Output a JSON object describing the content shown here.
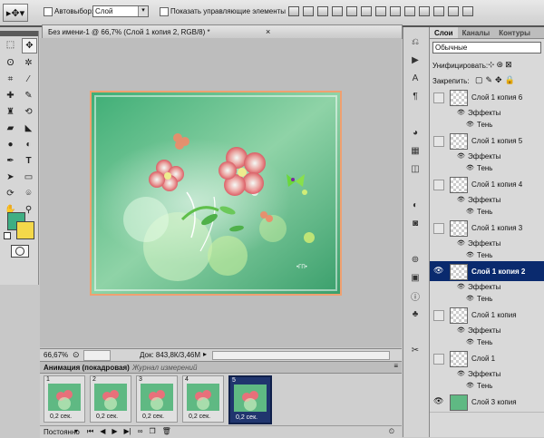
{
  "options_bar": {
    "autoselect_label": "Автовыбор:",
    "autoselect_value": "Слой",
    "show_controls_label": "Показать управляющие элементы"
  },
  "document": {
    "tab_title": "Без имени-1 @ 66,7% (Слой 1 копия 2, RGB/8) *",
    "zoom": "66,67%",
    "doc_info": "Док: 843,8К/3,46М",
    "watermark": "•ГП•"
  },
  "animation": {
    "tab_frames": "Анимация (покадровая)",
    "tab_measure": "Журнал измерений",
    "frames": [
      {
        "num": "1",
        "delay": "0,2 сек.",
        "selected": false
      },
      {
        "num": "2",
        "delay": "0,2 сек.",
        "selected": false
      },
      {
        "num": "3",
        "delay": "0,2 сек.",
        "selected": false
      },
      {
        "num": "4",
        "delay": "0,2 сек.",
        "selected": false
      },
      {
        "num": "5",
        "delay": "0,2 сек.",
        "selected": true
      }
    ],
    "loop": "Постоянно"
  },
  "layers_panel": {
    "tabs": [
      "Слои",
      "Каналы",
      "Контуры"
    ],
    "blend_mode": "Обычные",
    "unify_label": "Унифицировать:",
    "lock_label": "Закрепить:",
    "effects_label": "Эффекты",
    "shadow_label": "Тень",
    "layers": [
      {
        "name": "Слой 1 копия 6",
        "visible": false,
        "active": false
      },
      {
        "name": "Слой 1 копия 5",
        "visible": false,
        "active": false
      },
      {
        "name": "Слой 1 копия 4",
        "visible": false,
        "active": false
      },
      {
        "name": "Слой 1 копия 3",
        "visible": false,
        "active": false
      },
      {
        "name": "Слой 1 копия 2",
        "visible": true,
        "active": true
      },
      {
        "name": "Слой 1 копия",
        "visible": false,
        "active": false
      },
      {
        "name": "Слой 1",
        "visible": false,
        "active": false
      },
      {
        "name": "Слой 3 копия",
        "visible": true,
        "active": false
      }
    ]
  },
  "colors": {
    "foreground": "#3fae83",
    "background": "#f4d84a",
    "selection": "#0a2a6e",
    "canvas_frame": "#f0a070"
  }
}
